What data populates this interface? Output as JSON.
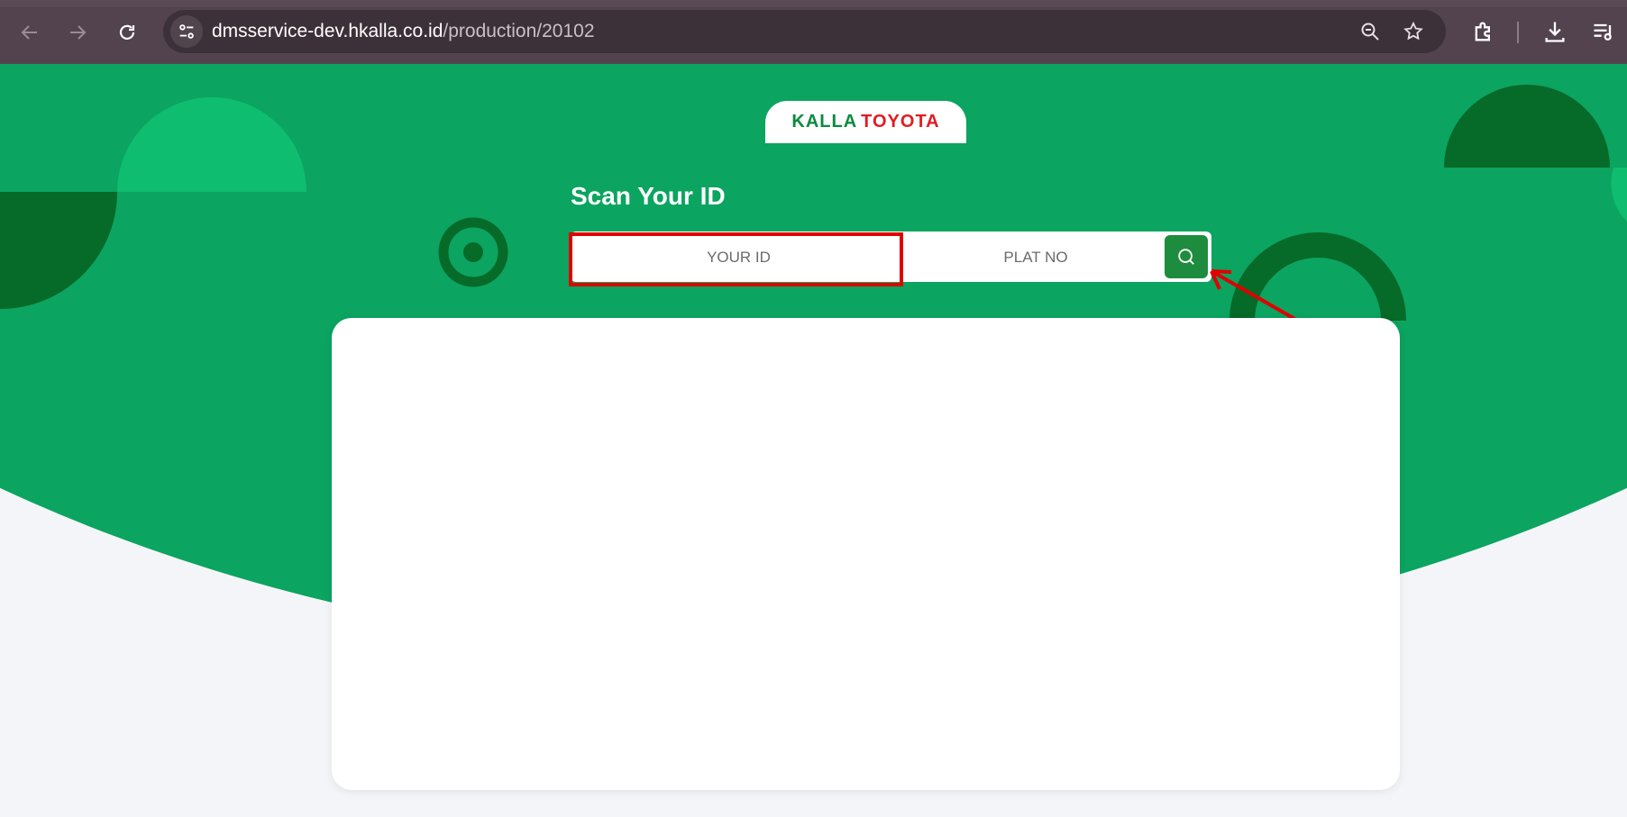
{
  "browser": {
    "url_domain": "dmsservice-dev.hkalla.co.id",
    "url_path": "/production/20102",
    "icons": [
      "back-icon",
      "forward-icon",
      "reload-icon",
      "site-info-icon",
      "zoom-out-icon",
      "star-icon",
      "extensions-icon",
      "download-icon",
      "reading-list-icon"
    ]
  },
  "logo": {
    "brand_left": "KALLA",
    "brand_right": "TOYOTA"
  },
  "scan": {
    "title": "Scan Your ID",
    "id_placeholder": "YOUR ID",
    "plat_placeholder": "PLAT NO"
  },
  "colors": {
    "brand_green": "#0ba460",
    "dark_green": "#066a28",
    "button_green": "#1e8c3e",
    "highlight_red": "#e00000"
  }
}
